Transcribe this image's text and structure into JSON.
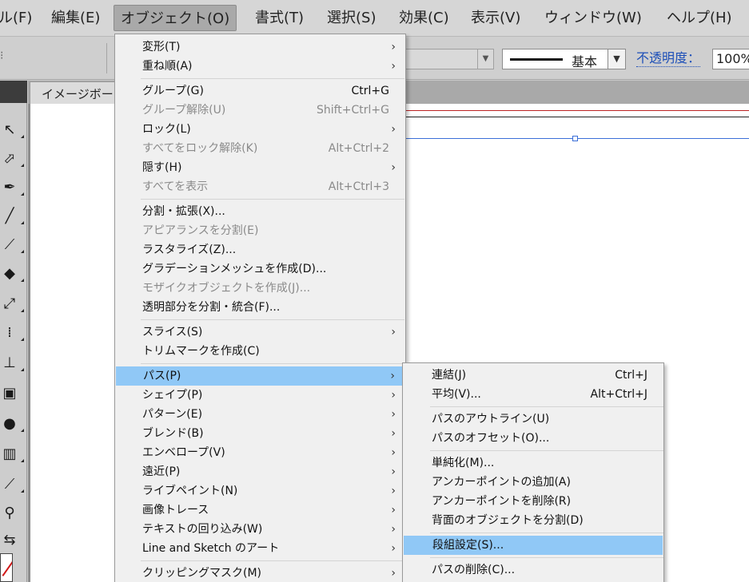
{
  "menubar": {
    "items": [
      "ル(F)",
      "編集(E)",
      "オブジェクト(O)",
      "書式(T)",
      "選択(S)",
      "効果(C)",
      "表示(V)",
      "ウィンドウ(W)",
      "ヘルプ(H)"
    ],
    "active_index": 2
  },
  "controlbar": {
    "grip": "⁝",
    "stroke_profile": "基本",
    "opacity_label": "不透明度：",
    "opacity_value": "100%",
    "dropdown_arrow": "▼"
  },
  "document": {
    "tab_title": "イメージボード"
  },
  "object_menu": {
    "items": [
      {
        "label": "変形(T)",
        "submenu": true
      },
      {
        "label": "重ね順(A)",
        "submenu": true
      },
      {
        "separator": true
      },
      {
        "label": "グループ(G)",
        "shortcut": "Ctrl+G"
      },
      {
        "label": "グループ解除(U)",
        "shortcut": "Shift+Ctrl+G",
        "disabled": true
      },
      {
        "label": "ロック(L)",
        "submenu": true
      },
      {
        "label": "すべてをロック解除(K)",
        "shortcut": "Alt+Ctrl+2",
        "disabled": true
      },
      {
        "label": "隠す(H)",
        "submenu": true
      },
      {
        "label": "すべてを表示",
        "shortcut": "Alt+Ctrl+3",
        "disabled": true
      },
      {
        "separator": true
      },
      {
        "label": "分割・拡張(X)..."
      },
      {
        "label": "アピアランスを分割(E)",
        "disabled": true
      },
      {
        "label": "ラスタライズ(Z)..."
      },
      {
        "label": "グラデーションメッシュを作成(D)..."
      },
      {
        "label": "モザイクオブジェクトを作成(J)...",
        "disabled": true
      },
      {
        "label": "透明部分を分割・統合(F)..."
      },
      {
        "separator": true
      },
      {
        "label": "スライス(S)",
        "submenu": true
      },
      {
        "label": "トリムマークを作成(C)"
      },
      {
        "separator": true
      },
      {
        "label": "パス(P)",
        "submenu": true,
        "highlight": true
      },
      {
        "label": "シェイプ(P)",
        "submenu": true
      },
      {
        "label": "パターン(E)",
        "submenu": true
      },
      {
        "label": "ブレンド(B)",
        "submenu": true
      },
      {
        "label": "エンベロープ(V)",
        "submenu": true
      },
      {
        "label": "遠近(P)",
        "submenu": true
      },
      {
        "label": "ライブペイント(N)",
        "submenu": true
      },
      {
        "label": "画像トレース",
        "submenu": true
      },
      {
        "label": "テキストの回り込み(W)",
        "submenu": true
      },
      {
        "label": "Line and Sketch のアート",
        "submenu": true
      },
      {
        "separator": true
      },
      {
        "label": "クリッピングマスク(M)",
        "submenu": true
      }
    ],
    "chevron": "›"
  },
  "path_submenu": {
    "items": [
      {
        "label": "連結(J)",
        "shortcut": "Ctrl+J"
      },
      {
        "label": "平均(V)...",
        "shortcut": "Alt+Ctrl+J"
      },
      {
        "separator": true
      },
      {
        "label": "パスのアウトライン(U)"
      },
      {
        "label": "パスのオフセット(O)..."
      },
      {
        "separator": true
      },
      {
        "label": "単純化(M)..."
      },
      {
        "label": "アンカーポイントの追加(A)"
      },
      {
        "label": "アンカーポイントを削除(R)"
      },
      {
        "label": "背面のオブジェクトを分割(D)"
      },
      {
        "separator": true
      },
      {
        "label": "段組設定(S)...",
        "highlight": true
      },
      {
        "separator": true
      },
      {
        "label": "パスの削除(C)..."
      }
    ]
  },
  "tools": [
    "direct-selection-tool-icon",
    "group-selection-tool-icon",
    "pen-tool-icon",
    "line-tool-icon",
    "paintbrush-tool-icon",
    "eraser-tool-icon",
    "scale-tool-icon",
    "free-transform-tool-icon",
    "shape-builder-tool-icon",
    "gradient-tool-icon",
    "blend-tool-icon",
    "graph-tool-icon",
    "eyedropper-tool-icon",
    "zoom-tool-icon",
    "swap-colors-icon"
  ]
}
